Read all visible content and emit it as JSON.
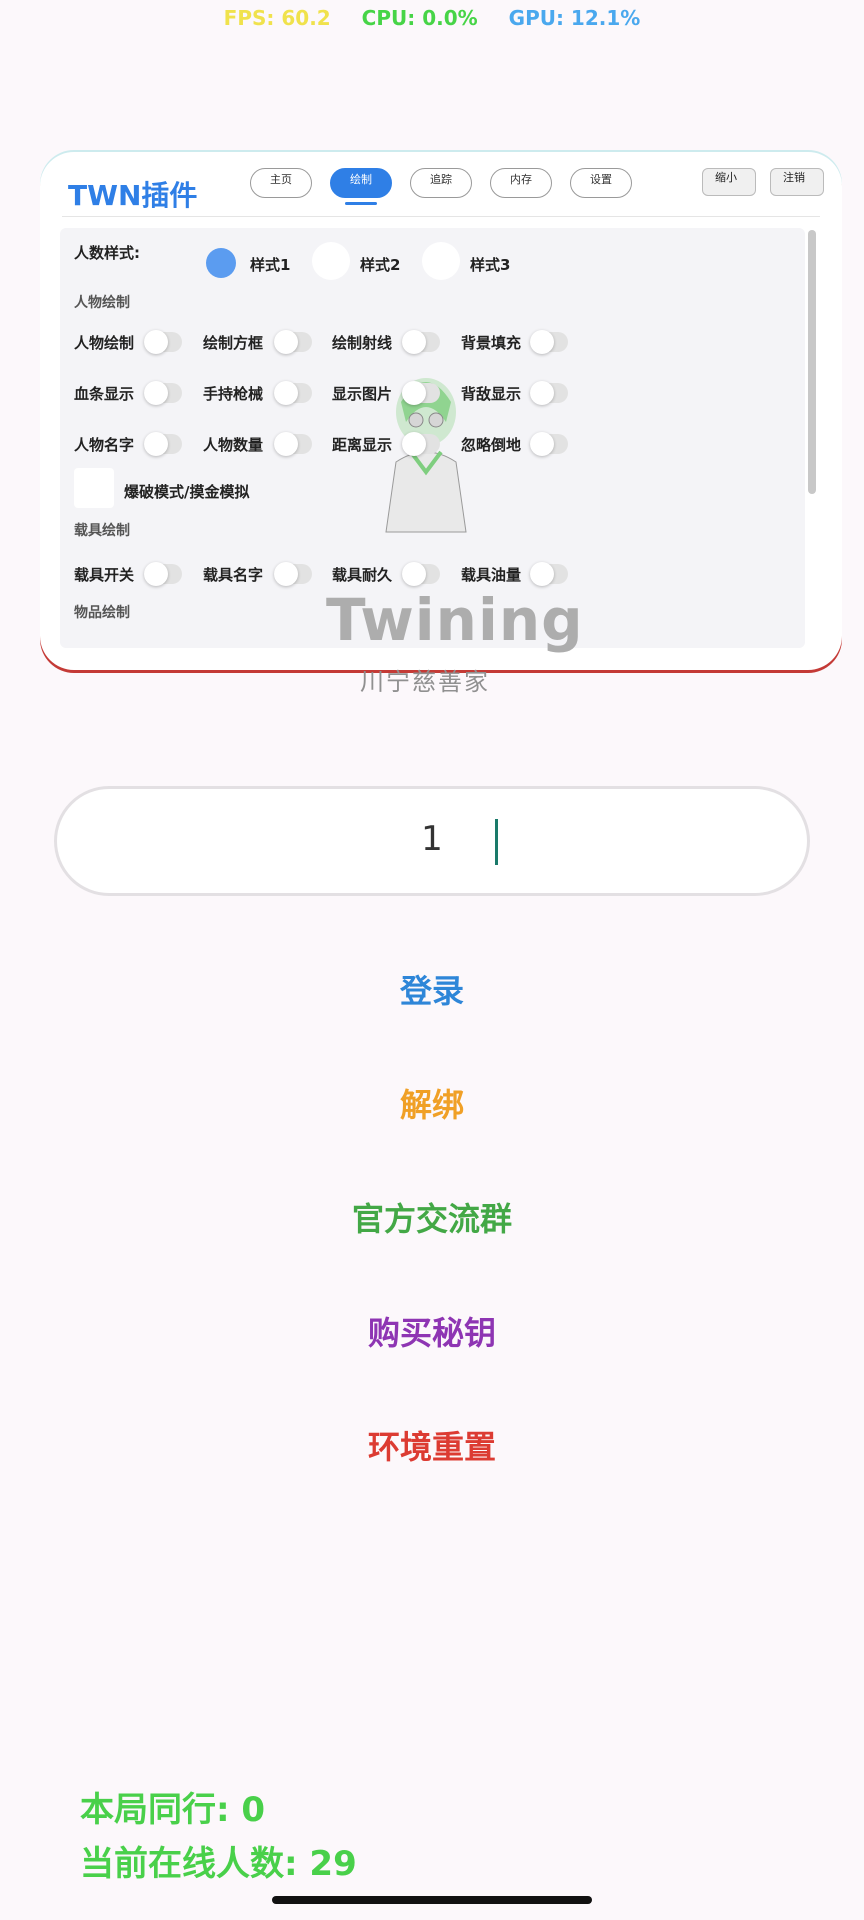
{
  "stats": {
    "fps": "FPS: 60.2",
    "cpu": "CPU: 0.0%",
    "gpu": "GPU: 12.1%"
  },
  "panel": {
    "brand": "TWN插件",
    "tabs": [
      "主页",
      "绘制",
      "追踪",
      "内存",
      "设置"
    ],
    "active_tab": "绘制",
    "minimize": "缩小",
    "logout": "注销",
    "player_style": {
      "label": "人数样式:",
      "options": [
        "样式1",
        "样式2",
        "样式3"
      ],
      "selected": "样式1"
    },
    "sections": {
      "person": "人物绘制",
      "vehicle": "载具绘制",
      "item": "物品绘制"
    },
    "person_toggles": [
      "人物绘制",
      "绘制方框",
      "绘制射线",
      "背景填充",
      "血条显示",
      "手持枪械",
      "显示图片",
      "背敌显示",
      "人物名字",
      "人物数量",
      "距离显示",
      "忽略倒地"
    ],
    "mode_checkbox": "爆破模式/摸金模拟",
    "vehicle_toggles": [
      "载具开关",
      "载具名字",
      "载具耐久",
      "载具油量"
    ]
  },
  "watermark": {
    "title": "Twining",
    "subtitle": "川宁慈善家"
  },
  "input": {
    "value": "1"
  },
  "actions": {
    "login": {
      "label": "登录",
      "color": "#2e86d8"
    },
    "unbind": {
      "label": "解绑",
      "color": "#f0a026"
    },
    "group": {
      "label": "官方交流群",
      "color": "#43a846"
    },
    "buy": {
      "label": "购买秘钥",
      "color": "#8e35b3"
    },
    "reset": {
      "label": "环境重置",
      "color": "#dc3b32"
    }
  },
  "bottom": {
    "peers": "本局同行: 0",
    "online": "当前在线人数: 29"
  }
}
